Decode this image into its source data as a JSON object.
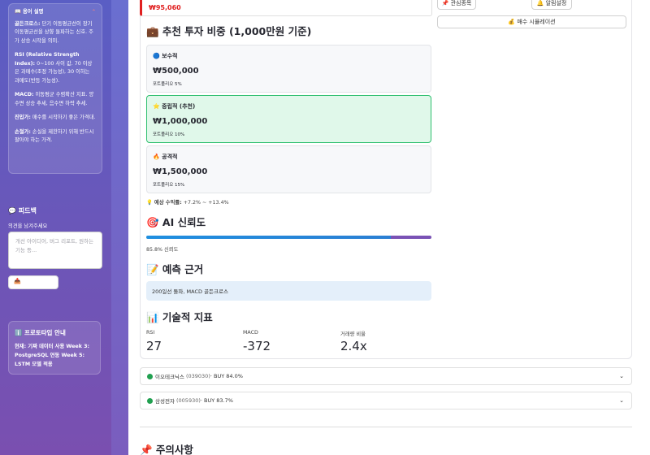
{
  "sidebar": {
    "glossary": {
      "title": "📖 용어 설명",
      "items": [
        {
          "term": "골든크로스:",
          "desc": " 단기 이동평균선이 장기 이동평균선을 상향 돌파하는 신호. 주가 상승 시작을 의미."
        },
        {
          "term": "RSI (Relative Strength Index):",
          "desc": " 0~100 사이 값. 70 이상은 과매수(조정 가능성), 30 이하는 과매도(반등 가능성)."
        },
        {
          "term": "MACD:",
          "desc": " 이동평균 수렴확산 지표. 양수면 상승 추세, 음수면 하락 추세."
        },
        {
          "term": "진입가:",
          "desc": " 매수를 시작하기 좋은 가격대."
        },
        {
          "term": "손절가:",
          "desc": " 손실을 제한하기 위해 반드시 팔아야 하는 가격."
        }
      ]
    },
    "feedback": {
      "title": "💬 피드백",
      "label": "의견을 남겨주세요",
      "placeholder": "개선 아이디어, 버그 리포트, 원하는 기능 등...",
      "submit": "📤"
    },
    "prototype": {
      "title": "ℹ️ 프로토타입 안내",
      "text": "현재: 기짜 데이터 사용 Week 3: PostgreSQL 연동 Week 5: LSTM 모델 적용"
    }
  },
  "main": {
    "price": "₩95,060",
    "buttons": {
      "watchlist": "📌 관심종목",
      "alert": "🔔 알림설정",
      "simulate": "💰 매수 시뮬레이션"
    },
    "allocation": {
      "title": "💼 추천 투자 비중 (1,000만원 기준)",
      "plans": [
        {
          "name": "🔵 보수적",
          "amount": "₩500,000",
          "pct": "포트폴리오 5%"
        },
        {
          "name": "⭐ 중립적 (추천)",
          "amount": "₩1,000,000",
          "pct": "포트폴리오 10%"
        },
        {
          "name": "🔥 공격적",
          "amount": "₩1,500,000",
          "pct": "포트폴리오 15%"
        }
      ],
      "expected_label": "💡 예상 수익률:",
      "expected_value": " +7.2% ~ +13.4%"
    },
    "confidence": {
      "title": "🎯 AI 신뢰도",
      "value": 0.858,
      "label": "85.8% 신뢰도"
    },
    "reason": {
      "title": "📝 예측 근거",
      "text": "200일선 돌파, MACD 골든크로스"
    },
    "technical": {
      "title": "📊 기술적 지표",
      "metrics": [
        {
          "label": "RSI",
          "value": "27"
        },
        {
          "label": "MACD",
          "value": "-372"
        },
        {
          "label": "거래량 비율",
          "value": "2.4x"
        }
      ]
    },
    "stocks": [
      {
        "name": "이오테크닉스",
        "code": "(039030)",
        "signal": " · BUY 84.0%"
      },
      {
        "name": "삼성전자",
        "code": "(005930)",
        "signal": " · BUY 83.7%"
      }
    ],
    "caution_title": "📌 주의사항"
  },
  "colors": {
    "accent_red": "#e02020",
    "highlight_green": "#2fbf6f",
    "sidebar": "#5a5ec4"
  }
}
